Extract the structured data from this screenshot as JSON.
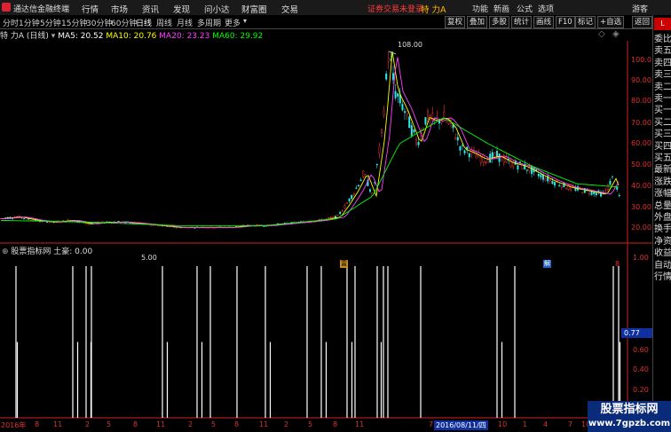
{
  "app": {
    "title": "通达信金融终端",
    "menus": [
      "行情",
      "市场",
      "资讯",
      "发现",
      "问小达",
      "财富圈",
      "交易"
    ],
    "warning": "证券交易未登录",
    "stock_name": "特 力A",
    "right_menus": [
      "功能",
      "新画",
      "公式",
      "选项"
    ],
    "guest": "游客"
  },
  "periods": [
    "分时",
    "1分钟",
    "5分钟",
    "15分钟",
    "30分钟",
    "60分钟",
    "日线",
    "周线",
    "月线",
    "多周期",
    "更多"
  ],
  "active_period": "日线",
  "tools": [
    "复权",
    "叠加",
    "多股",
    "统计",
    "画线",
    "F10",
    "标记",
    "+自选",
    "返回"
  ],
  "info": {
    "name": "特 力A (日线)",
    "ma5": "MA5: 20.52",
    "ma10": "MA10: 20.76",
    "ma20": "MA20: 23.23",
    "ma60": "MA60: 29.92"
  },
  "right_tabs": [
    "委比",
    "卖五",
    "卖四",
    "卖三",
    "卖二",
    "卖一",
    "买一",
    "买二",
    "买三",
    "买四",
    "买五",
    "最新",
    "涨跌",
    "涨幅",
    "总量",
    "外盘",
    "换手",
    "净资",
    "收益",
    "自动",
    "行情"
  ],
  "price_axis": [
    "100.0",
    "90.00",
    "80.00",
    "70.00",
    "60.00",
    "50.00",
    "40.00",
    "30.00",
    "20.00"
  ],
  "price_high_label": "108.00",
  "price_low_label": "5.00",
  "markers": [
    "富",
    "解",
    "8"
  ],
  "indicator": {
    "title": "股票指标网 土豪: 0.00",
    "axis": [
      "1.00",
      "0.60",
      "0.40",
      "0.20"
    ],
    "current": "0.77"
  },
  "date_axis": [
    "2016年",
    "8",
    "11",
    "2",
    "5",
    "8",
    "11",
    "2",
    "5",
    "8",
    "11",
    "2",
    "5",
    "8",
    "11",
    "2016/08/11/四",
    "7",
    "10",
    "1",
    "4",
    "7",
    "10"
  ],
  "watermark": {
    "line1": "股票指标网",
    "line2": "www.7gpzb.com"
  },
  "colors": {
    "up": "#ff3b3b",
    "down": "#2ee6e6",
    "ma5": "#ffffff",
    "ma10": "#ffff00",
    "ma20": "#ff40ff",
    "ma60": "#00ff00",
    "axis": "#e03030"
  },
  "chart_data": [
    {
      "type": "candlestick",
      "title": "特 力A (日线)",
      "series": [
        {
          "name": "price",
          "x": [
            0,
            20,
            40,
            60,
            80,
            100,
            120,
            140,
            160,
            180,
            200,
            220,
            240,
            260,
            280,
            300,
            320,
            340,
            360,
            380,
            390,
            400,
            410,
            420,
            430,
            438,
            445,
            455,
            470,
            480,
            490,
            500,
            510,
            520,
            530,
            545,
            560,
            575,
            590,
            605,
            620,
            640,
            660,
            680,
            690,
            700
          ],
          "values": [
            12,
            13,
            11,
            10,
            11,
            9,
            10,
            10,
            9,
            8,
            7,
            7,
            7,
            7,
            8,
            8,
            9,
            10,
            11,
            13,
            20,
            28,
            38,
            25,
            60,
            108,
            85,
            75,
            55,
            70,
            68,
            70,
            64,
            52,
            50,
            46,
            48,
            44,
            42,
            38,
            34,
            30,
            28,
            26,
            35,
            22
          ]
        },
        {
          "name": "MA60",
          "x": [
            0,
            100,
            200,
            300,
            380,
            420,
            450,
            500,
            550,
            600,
            650,
            700
          ],
          "values": [
            11,
            10,
            8,
            8,
            12,
            25,
            55,
            70,
            55,
            42,
            32,
            30
          ]
        }
      ],
      "ylim": [
        0,
        110
      ]
    },
    {
      "type": "bar",
      "title": "股票指标网 土豪: 0.00",
      "values_note": "binary signal bars with values 1.0 or 0.5",
      "ylim": [
        0,
        1.0
      ]
    }
  ]
}
